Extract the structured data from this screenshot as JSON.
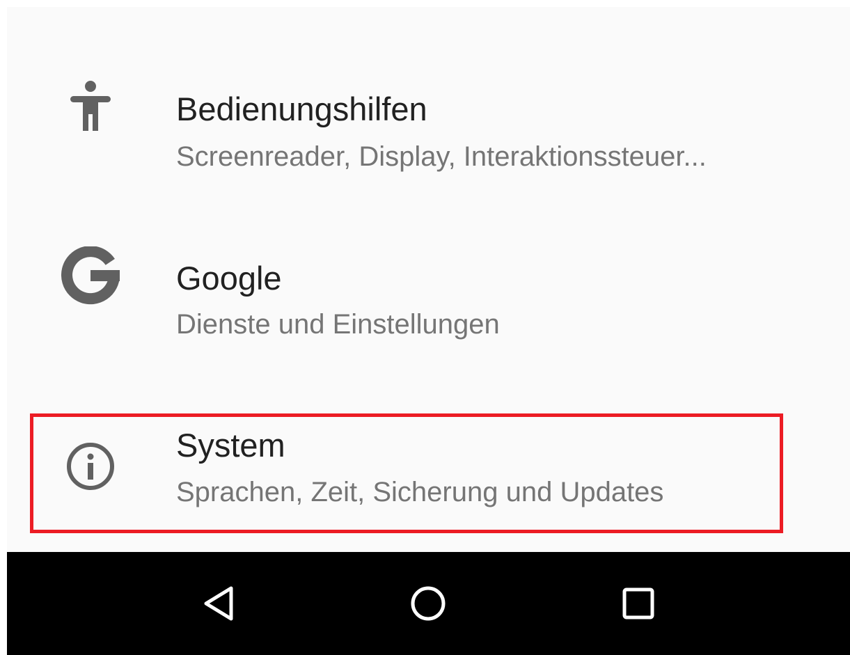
{
  "settings": {
    "items": [
      {
        "icon": "accessibility-icon",
        "title": "Bedienungshilfen",
        "subtitle": "Screenreader, Display, Interaktionssteuer..."
      },
      {
        "icon": "google-g-icon",
        "title": "Google",
        "subtitle": "Dienste und Einstellungen"
      },
      {
        "icon": "info-icon",
        "title": "System",
        "subtitle": "Sprachen, Zeit, Sicherung und Updates",
        "highlighted": true
      }
    ]
  },
  "navbar": {
    "buttons": [
      "back-icon",
      "home-icon",
      "recents-icon"
    ]
  },
  "colors": {
    "background": "#fafafa",
    "title_text": "#212121",
    "subtitle_text": "#757575",
    "icon": "#616161",
    "highlight_border": "#ec1c24",
    "navbar_background": "#000000",
    "navbar_icon": "#ffffff"
  }
}
